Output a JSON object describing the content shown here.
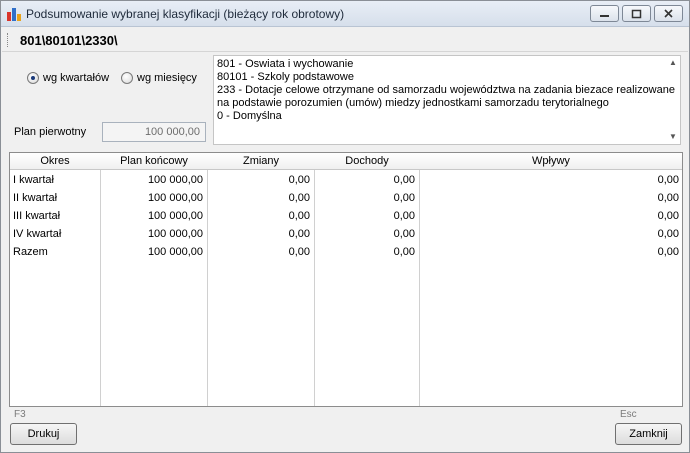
{
  "window": {
    "title": "Podsumowanie wybranej klasyfikacji (bieżący rok obrotowy)"
  },
  "path": "801\\80101\\2330\\",
  "period_options": [
    {
      "label": "wg kwartałów",
      "selected": true
    },
    {
      "label": "wg miesięcy",
      "selected": false
    }
  ],
  "plan": {
    "label": "Plan pierwotny",
    "value": "100 000,00"
  },
  "description_lines": [
    "801 - Oswiata i wychowanie",
    "80101 - Szkoly podstawowe",
    "233 - Dotacje celowe otrzymane od samorzadu województwa na zadania biezace realizowane",
    "na podstawie porozumien (umów) miedzy jednostkami samorzadu terytorialnego",
    "0 - Domyślna"
  ],
  "table": {
    "headers": [
      "Okres",
      "Plan końcowy",
      "Zmiany",
      "Dochody",
      "Wpływy"
    ],
    "rows": [
      [
        "I kwartał",
        "100 000,00",
        "0,00",
        "0,00",
        "0,00"
      ],
      [
        "II kwartał",
        "100 000,00",
        "0,00",
        "0,00",
        "0,00"
      ],
      [
        "III kwartał",
        "100 000,00",
        "0,00",
        "0,00",
        "0,00"
      ],
      [
        "IV kwartał",
        "100 000,00",
        "0,00",
        "0,00",
        "0,00"
      ],
      [
        "Razem",
        "100 000,00",
        "0,00",
        "0,00",
        "0,00"
      ]
    ]
  },
  "footer": {
    "print_hint": "F3",
    "print_label": "Drukuj",
    "close_hint": "Esc",
    "close_label": "Zamknij"
  },
  "colors": {
    "titlebar": "#dbe3ee",
    "window_bg": "#f0f0f0",
    "grid_lines": "#d0d0d0"
  }
}
